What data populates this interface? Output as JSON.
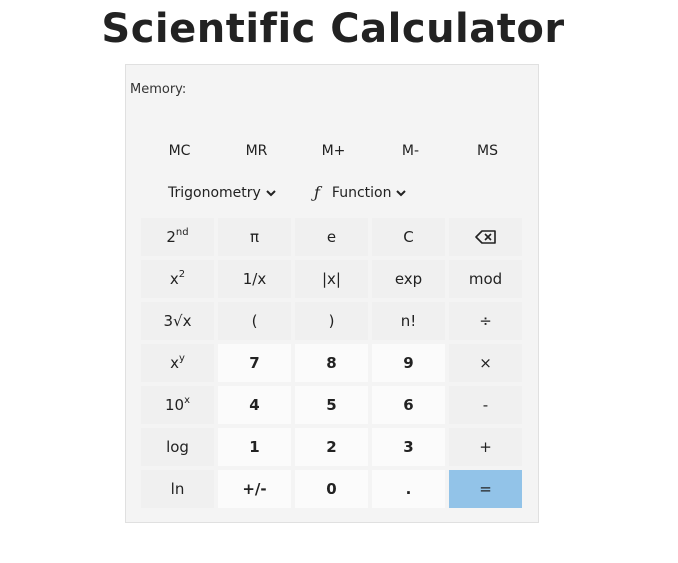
{
  "title": "Scientific Calculator",
  "memory": {
    "label": "Memory:",
    "buttons": [
      "MC",
      "MR",
      "M+",
      "M-",
      "MS"
    ]
  },
  "dropdowns": {
    "trigonometry": "Trigonometry",
    "function_icon": "ƒ",
    "function": "Function"
  },
  "keys": {
    "second_base": "2",
    "second_sup": "nd",
    "pi": "π",
    "e": "e",
    "clear": "C",
    "backspace": "⌫",
    "square_base": "x",
    "square_sup": "2",
    "reciprocal": "1/x",
    "abs": "|x|",
    "exp": "exp",
    "mod": "mod",
    "cube_root": "3√x",
    "paren_open": "(",
    "paren_close": ")",
    "factorial": "n!",
    "divide": "÷",
    "power_base": "x",
    "power_sup": "y",
    "seven": "7",
    "eight": "8",
    "nine": "9",
    "multiply": "×",
    "ten_base": "10",
    "ten_sup": "x",
    "four": "4",
    "five": "5",
    "six": "6",
    "minus": "-",
    "log": "log",
    "one": "1",
    "two": "2",
    "three": "3",
    "plus": "+",
    "ln": "ln",
    "negate": "+/-",
    "zero": "0",
    "decimal": ".",
    "equals": "="
  },
  "colors": {
    "equals_key": "#92c3e8",
    "panel": "#f4f4f4"
  }
}
